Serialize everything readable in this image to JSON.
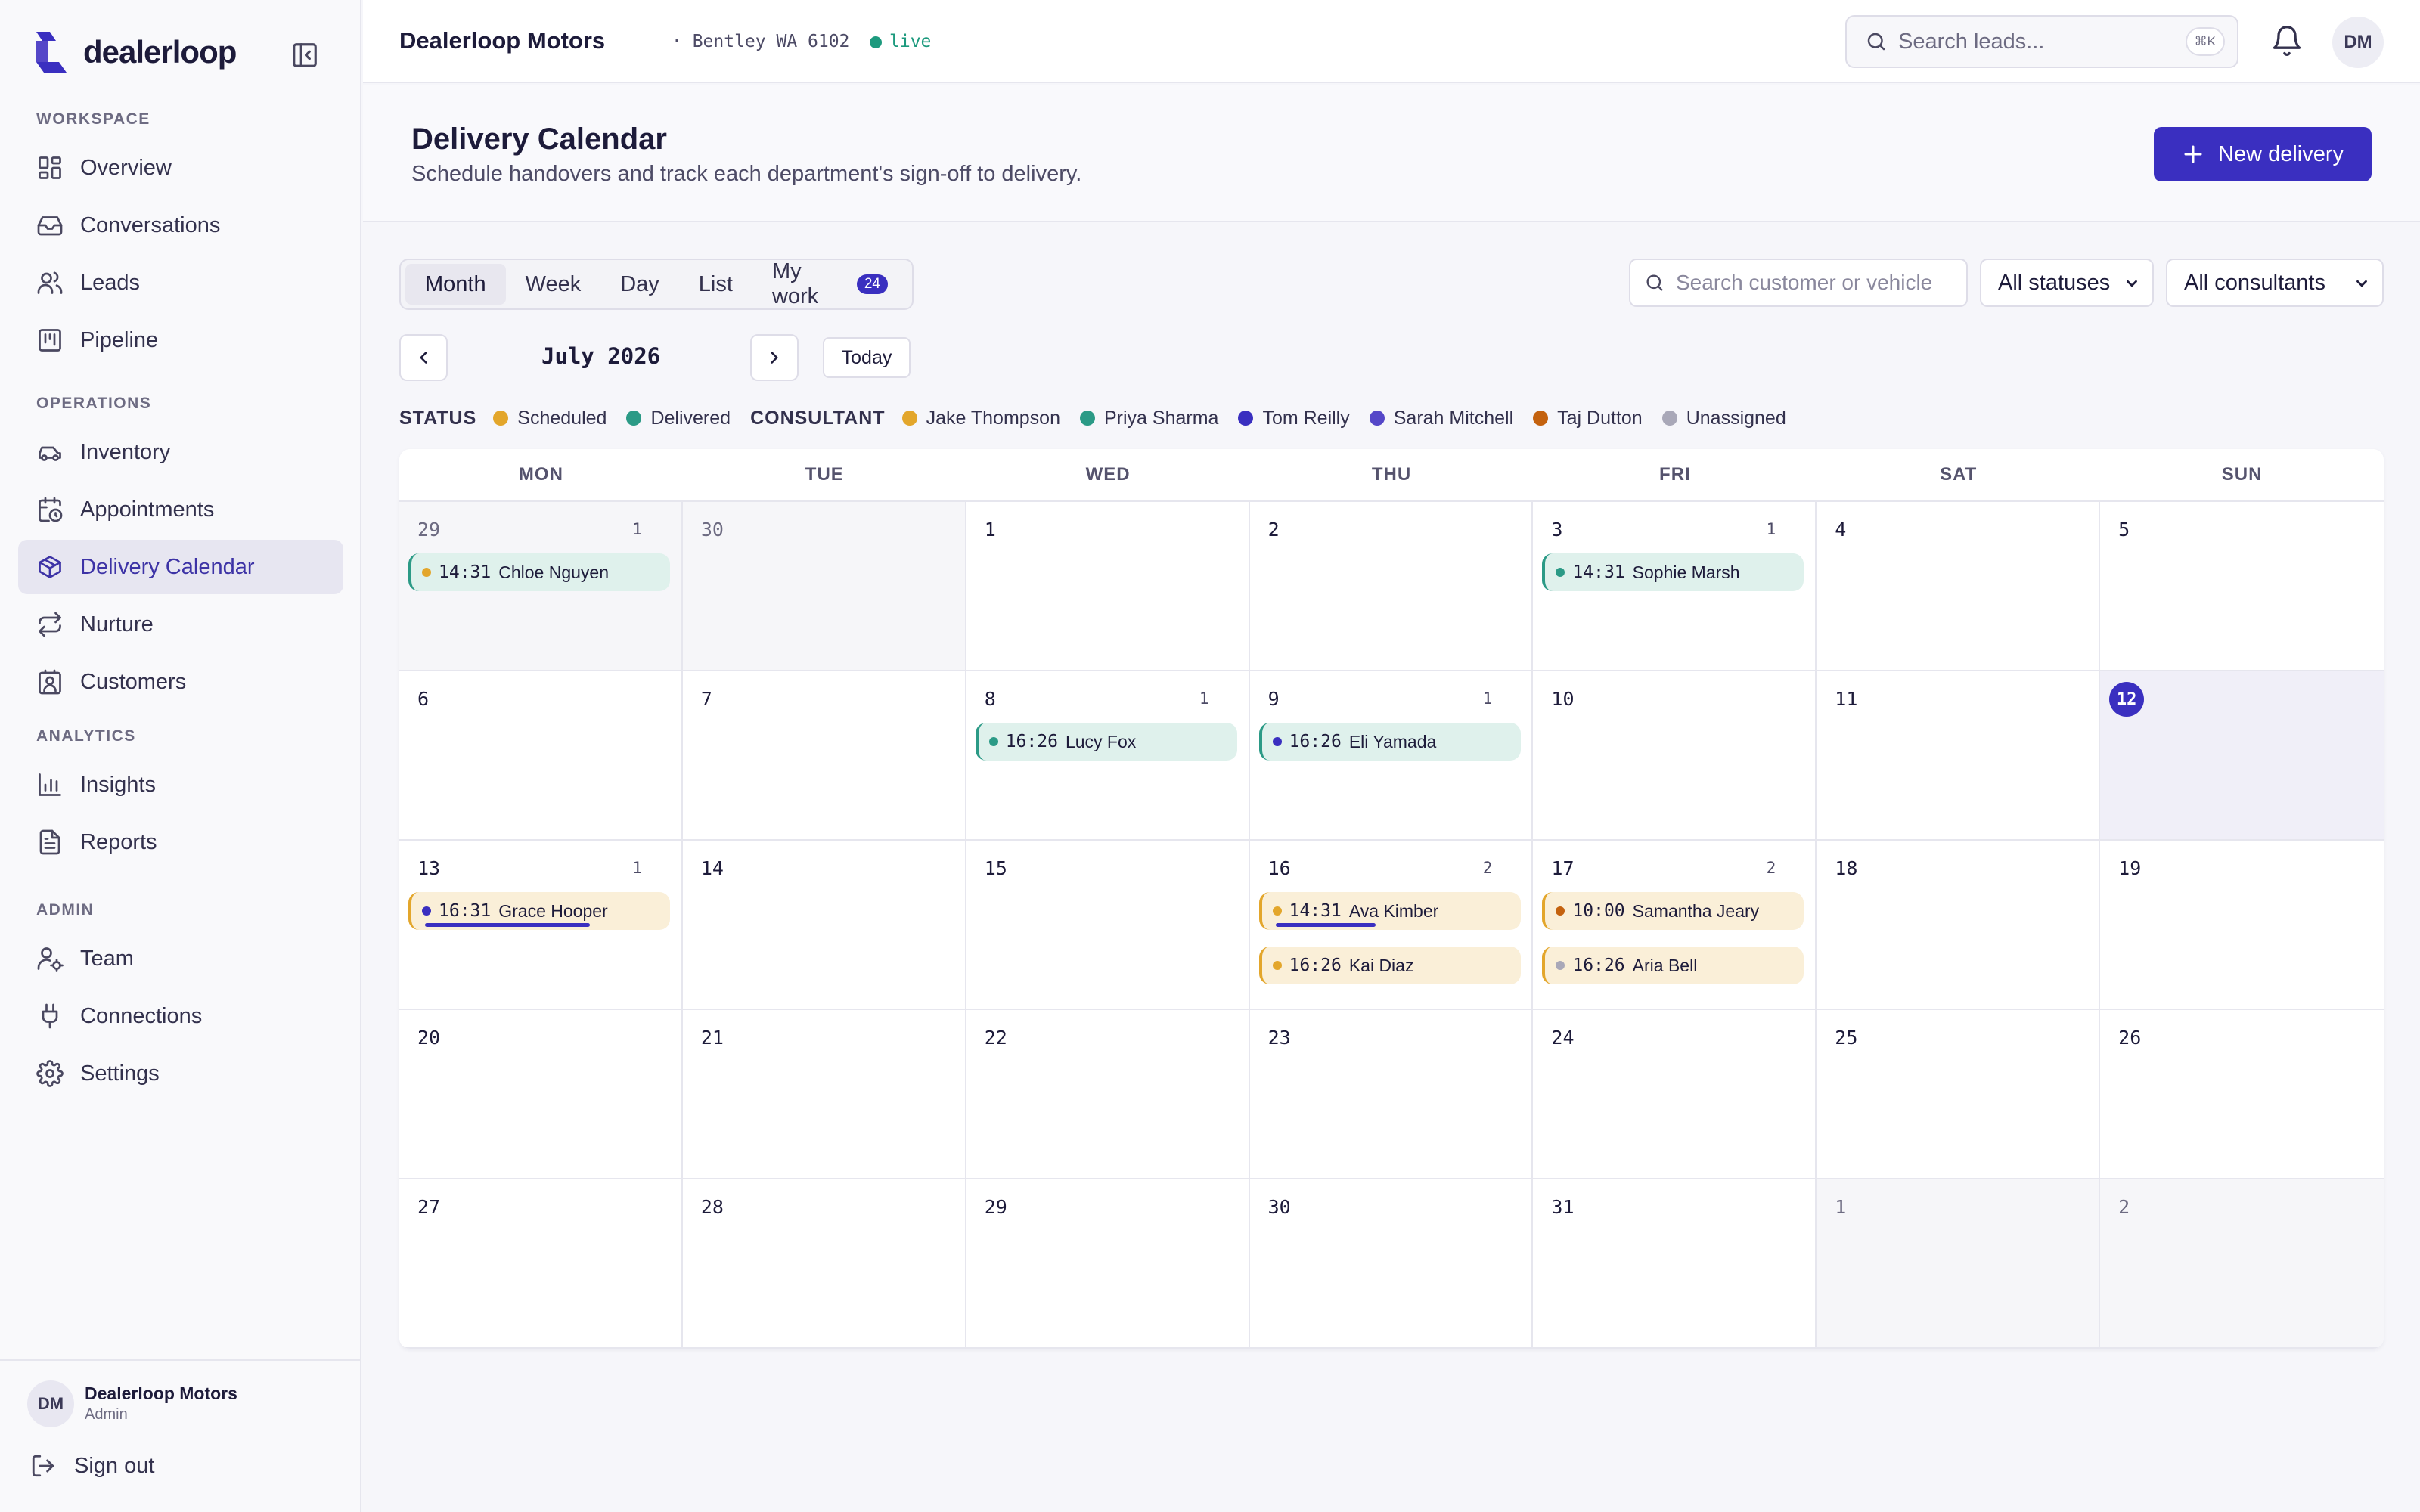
{
  "sidebar": {
    "brand": "dealerloop",
    "sections": [
      {
        "label": "WORKSPACE",
        "items": [
          {
            "label": "Overview",
            "icon": "grid-icon"
          },
          {
            "label": "Conversations",
            "icon": "inbox-icon"
          },
          {
            "label": "Leads",
            "icon": "users-icon"
          },
          {
            "label": "Pipeline",
            "icon": "kanban-icon"
          }
        ]
      },
      {
        "label": "OPERATIONS",
        "items": [
          {
            "label": "Inventory",
            "icon": "car-icon"
          },
          {
            "label": "Appointments",
            "icon": "calendar-clock-icon"
          },
          {
            "label": "Delivery Calendar",
            "icon": "package-icon",
            "active": true
          },
          {
            "label": "Nurture",
            "icon": "repeat-icon"
          },
          {
            "label": "Customers",
            "icon": "contact-icon"
          }
        ]
      },
      {
        "label": "ANALYTICS",
        "items": [
          {
            "label": "Insights",
            "icon": "bar-chart-icon"
          },
          {
            "label": "Reports",
            "icon": "file-text-icon"
          }
        ]
      },
      {
        "label": "ADMIN",
        "items": [
          {
            "label": "Team",
            "icon": "user-cog-icon"
          },
          {
            "label": "Connections",
            "icon": "plug-icon"
          },
          {
            "label": "Settings",
            "icon": "gear-icon"
          }
        ]
      }
    ],
    "account": {
      "initials": "DM",
      "name": "Dealerloop Motors",
      "role": "Admin"
    },
    "sign_out": "Sign out"
  },
  "topbar": {
    "dealer_name": "Dealerloop Motors",
    "location": "· Bentley WA 6102",
    "live": "live",
    "search_placeholder": "Search leads...",
    "search_shortcut": "⌘K",
    "user_initials": "DM"
  },
  "page": {
    "title": "Delivery Calendar",
    "subtitle": "Schedule handovers and track each department's sign-off to delivery.",
    "new_button": "New delivery"
  },
  "views": [
    {
      "label": "Month",
      "active": true
    },
    {
      "label": "Week"
    },
    {
      "label": "Day"
    },
    {
      "label": "List"
    },
    {
      "label": "My work",
      "badge": "24"
    }
  ],
  "filters": {
    "search_placeholder": "Search customer or vehicle",
    "status": "All statuses",
    "consultant": "All consultants"
  },
  "month_label": "July 2026",
  "today_label": "Today",
  "legend": {
    "status_label": "STATUS",
    "statuses": [
      {
        "label": "Scheduled",
        "color": "#e3a62b"
      },
      {
        "label": "Delivered",
        "color": "#2b9a86"
      }
    ],
    "consultant_label": "CONSULTANT",
    "consultants": [
      {
        "label": "Jake Thompson",
        "color": "#e3a62b"
      },
      {
        "label": "Priya Sharma",
        "color": "#2b9a86"
      },
      {
        "label": "Tom Reilly",
        "color": "#3a2fc0"
      },
      {
        "label": "Sarah Mitchell",
        "color": "#5547c8"
      },
      {
        "label": "Taj Dutton",
        "color": "#c4620f"
      },
      {
        "label": "Unassigned",
        "color": "#a9a8b8"
      }
    ]
  },
  "weekdays": [
    "MON",
    "TUE",
    "WED",
    "THU",
    "FRI",
    "SAT",
    "SUN"
  ],
  "weeks": [
    [
      {
        "day": "29",
        "out": true,
        "count": "1",
        "events": [
          {
            "time": "14:31",
            "name": "Chloe Nguyen",
            "status": "delivered",
            "dot": "#e3a62b"
          }
        ]
      },
      {
        "day": "30",
        "out": true
      },
      {
        "day": "1"
      },
      {
        "day": "2"
      },
      {
        "day": "3",
        "count": "1",
        "events": [
          {
            "time": "14:31",
            "name": "Sophie Marsh",
            "status": "delivered",
            "dot": "#2b9a86"
          }
        ]
      },
      {
        "day": "4"
      },
      {
        "day": "5"
      }
    ],
    [
      {
        "day": "6"
      },
      {
        "day": "7"
      },
      {
        "day": "8",
        "count": "1",
        "events": [
          {
            "time": "16:26",
            "name": "Lucy Fox",
            "status": "delivered",
            "dot": "#2b9a86"
          }
        ]
      },
      {
        "day": "9",
        "count": "1",
        "events": [
          {
            "time": "16:26",
            "name": "Eli Yamada",
            "status": "delivered",
            "dot": "#3a2fc0"
          }
        ]
      },
      {
        "day": "10"
      },
      {
        "day": "11"
      },
      {
        "day": "12",
        "today": true
      }
    ],
    [
      {
        "day": "13",
        "count": "1",
        "events": [
          {
            "time": "16:31",
            "name": "Grace Hooper",
            "status": "scheduled",
            "dot": "#3a2fc0",
            "progress": 0.66
          }
        ]
      },
      {
        "day": "14"
      },
      {
        "day": "15"
      },
      {
        "day": "16",
        "count": "2",
        "events": [
          {
            "time": "14:31",
            "name": "Ava Kimber",
            "status": "scheduled",
            "dot": "#e3a62b",
            "progress": 0.4
          },
          {
            "time": "16:26",
            "name": "Kai Diaz",
            "status": "scheduled",
            "dot": "#e3a62b"
          }
        ]
      },
      {
        "day": "17",
        "count": "2",
        "events": [
          {
            "time": "10:00",
            "name": "Samantha Jeary",
            "status": "scheduled",
            "dot": "#c4620f"
          },
          {
            "time": "16:26",
            "name": "Aria Bell",
            "status": "scheduled",
            "dot": "#a9a8b8"
          }
        ]
      },
      {
        "day": "18"
      },
      {
        "day": "19"
      }
    ],
    [
      {
        "day": "20"
      },
      {
        "day": "21"
      },
      {
        "day": "22"
      },
      {
        "day": "23"
      },
      {
        "day": "24"
      },
      {
        "day": "25"
      },
      {
        "day": "26"
      }
    ],
    [
      {
        "day": "27"
      },
      {
        "day": "28"
      },
      {
        "day": "29"
      },
      {
        "day": "30"
      },
      {
        "day": "31"
      },
      {
        "day": "1",
        "out": true
      },
      {
        "day": "2",
        "out": true
      }
    ]
  ]
}
